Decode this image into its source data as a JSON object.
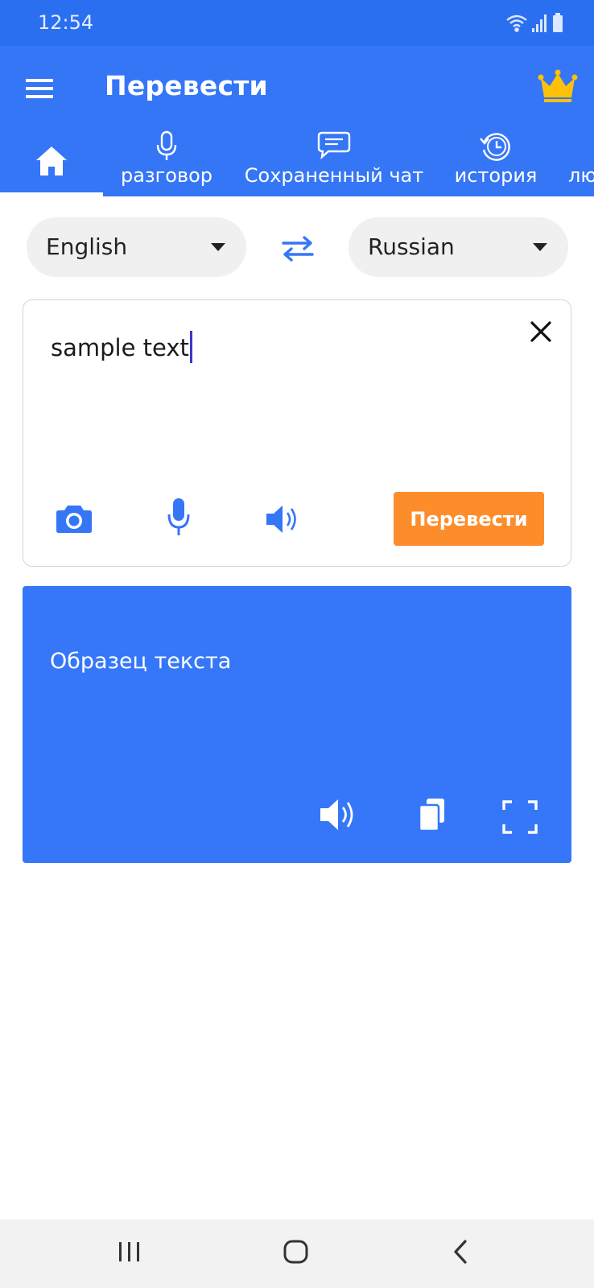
{
  "status_bar": {
    "time": "12:54",
    "icons": [
      "wifi-icon",
      "signal-icon",
      "battery-icon"
    ]
  },
  "app_bar": {
    "title": "Перевести",
    "menu_icon": "menu-icon",
    "premium_icon": "crown-icon",
    "crown_color": "#ffc107"
  },
  "tabs": [
    {
      "label": "",
      "icon": "home-icon",
      "active": true
    },
    {
      "label": "разговор",
      "icon": "microphone-icon"
    },
    {
      "label": "Сохраненный чат",
      "icon": "chat-bubble-icon"
    },
    {
      "label": "история",
      "icon": "history-icon"
    },
    {
      "label": "лю",
      "icon": ""
    }
  ],
  "languages": {
    "source": "English",
    "target": "Russian",
    "swap_icon": "swap-arrows-icon"
  },
  "input": {
    "value": "sample text",
    "translate_label": "Перевести",
    "translate_color": "#fd8c2b"
  },
  "output": {
    "text": "Образец текста"
  },
  "colors": {
    "primary": "#3576f7",
    "status_bar": "#2a6ff0",
    "output_background": "#3577f8",
    "accent": "#fd8c2b"
  }
}
